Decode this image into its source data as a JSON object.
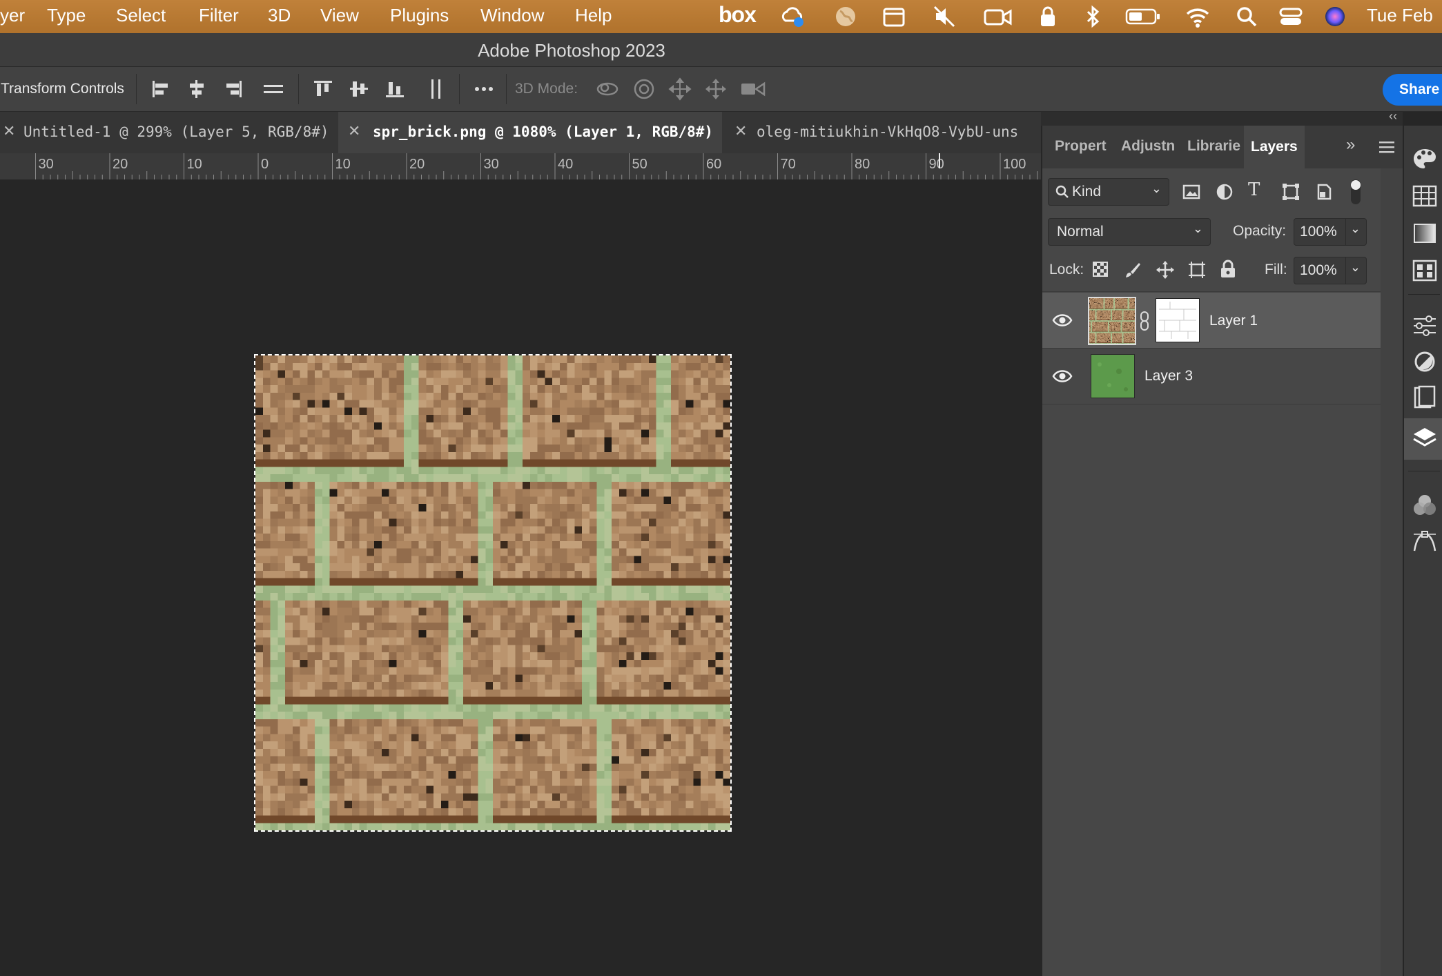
{
  "menubar": {
    "items": [
      "yer",
      "Type",
      "Select",
      "Filter",
      "3D",
      "View",
      "Plugins",
      "Window",
      "Help"
    ],
    "status_icons": [
      "box-logo",
      "creative-cloud-icon",
      "globe-icon",
      "calendar-icon",
      "mute-icon",
      "video-camera-icon",
      "lock-icon",
      "bluetooth-icon",
      "battery-icon",
      "wifi-icon",
      "search-icon",
      "control-center-icon",
      "siri-icon"
    ],
    "box_label": "box",
    "clock": "Tue Feb"
  },
  "app": {
    "title": "Adobe Photoshop 2023"
  },
  "options": {
    "transform_label": "Transform Controls",
    "mode_label": "3D Mode:",
    "share_label": "Share"
  },
  "tabs": [
    {
      "label": "Untitled-1 @ 299% (Layer 5, RGB/8#) *",
      "active": false
    },
    {
      "label": "spr_brick.png @ 1080% (Layer 1, RGB/8#) *",
      "active": true
    },
    {
      "label": "oleg-mitiukhin-VkHqO8-VybU-uns",
      "active": false
    }
  ],
  "ruler": {
    "labels": [
      "30",
      "20",
      "10",
      "0",
      "10",
      "20",
      "30",
      "40",
      "50",
      "60",
      "70",
      "80",
      "90",
      "100"
    ]
  },
  "layers_panel": {
    "tabs": [
      "Propert",
      "Adjustn",
      "Librarie",
      "Layers"
    ],
    "active_tab": "Layers",
    "filter_kind": "Kind",
    "blend_mode": "Normal",
    "opacity_label": "Opacity:",
    "opacity_value": "100%",
    "lock_label": "Lock:",
    "fill_label": "Fill:",
    "fill_value": "100%",
    "layers": [
      {
        "name": "Layer 1",
        "visible": true,
        "selected": true,
        "has_mask": true
      },
      {
        "name": "Layer 3",
        "visible": true,
        "selected": false,
        "has_mask": false
      }
    ]
  },
  "colors": {
    "menubar": "#b8772f",
    "accent_blue": "#1473e6",
    "brick_base": "#a98463",
    "mortar": "#a7c08f",
    "layer3_green": "#5d9a4c"
  }
}
